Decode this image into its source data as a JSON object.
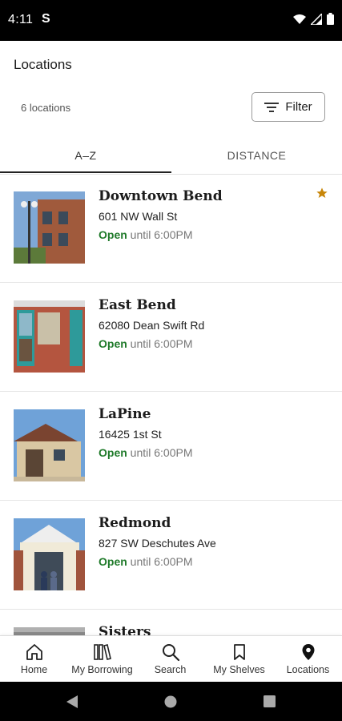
{
  "status_bar": {
    "time": "4:11",
    "app_indicator": "S",
    "icons": [
      "wifi-icon",
      "signal-icon",
      "battery-icon"
    ]
  },
  "header": {
    "title": "Locations",
    "count": "6 locations",
    "filter_label": "Filter"
  },
  "tabs": [
    {
      "label": "A–Z",
      "selected": true
    },
    {
      "label": "DISTANCE",
      "selected": false
    }
  ],
  "locations": [
    {
      "name": "Downtown Bend",
      "address": "601 NW Wall St",
      "status": "Open",
      "hours": "until 6:00PM",
      "favorite": true
    },
    {
      "name": "East Bend",
      "address": "62080 Dean Swift Rd",
      "status": "Open",
      "hours": "until 6:00PM",
      "favorite": false
    },
    {
      "name": "LaPine",
      "address": "16425 1st St",
      "status": "Open",
      "hours": "until 6:00PM",
      "favorite": false
    },
    {
      "name": "Redmond",
      "address": "827 SW Deschutes Ave",
      "status": "Open",
      "hours": "until 6:00PM",
      "favorite": false
    },
    {
      "name": "Sisters",
      "address": "",
      "status": "",
      "hours": "",
      "favorite": false
    }
  ],
  "bottom_nav": [
    {
      "label": "Home",
      "icon": "home-icon"
    },
    {
      "label": "My Borrowing",
      "icon": "books-icon"
    },
    {
      "label": "Search",
      "icon": "search-icon"
    },
    {
      "label": "My Shelves",
      "icon": "bookmark-icon"
    },
    {
      "label": "Locations",
      "icon": "location-pin-icon",
      "selected": true
    }
  ],
  "colors": {
    "open_green": "#1f7a2a",
    "favorite_star": "#c8860a",
    "text_dark": "#1c1c1c"
  }
}
